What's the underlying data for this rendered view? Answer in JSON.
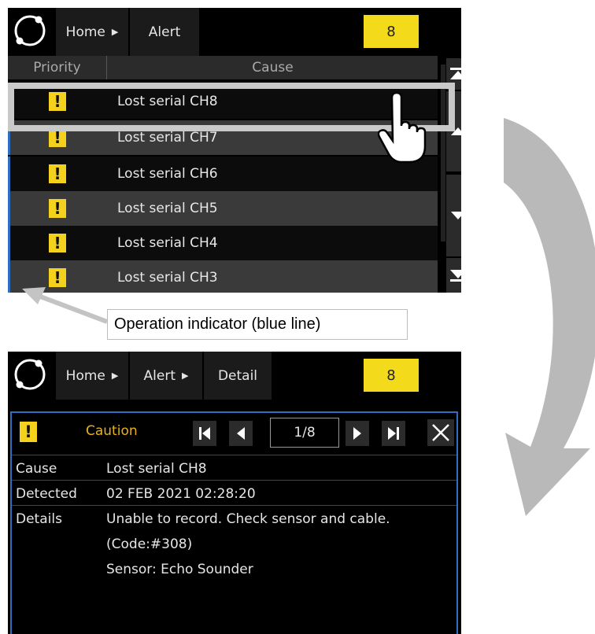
{
  "top_screen": {
    "breadcrumb": [
      "Home",
      "Alert"
    ],
    "alert_count": "8",
    "table": {
      "headers": [
        "Priority",
        "Cause"
      ],
      "rows": [
        {
          "priority_icon": "warning-icon",
          "cause": "Lost serial CH8"
        },
        {
          "priority_icon": "warning-icon",
          "cause": "Lost serial CH7"
        },
        {
          "priority_icon": "warning-icon",
          "cause": "Lost serial CH6"
        },
        {
          "priority_icon": "warning-icon",
          "cause": "Lost serial CH5"
        },
        {
          "priority_icon": "warning-icon",
          "cause": "Lost serial CH4"
        },
        {
          "priority_icon": "warning-icon",
          "cause": "Lost serial CH3"
        }
      ]
    },
    "scroll_buttons": [
      "scroll-top-icon",
      "scroll-up-icon",
      "scroll-down-icon",
      "scroll-bottom-icon"
    ]
  },
  "callout": "Operation indicator (blue line)",
  "bottom_screen": {
    "breadcrumb": [
      "Home",
      "Alert",
      "Detail"
    ],
    "alert_count": "8",
    "detail": {
      "priority_label": "Caution",
      "page": "1/8",
      "rows": [
        {
          "label": "Cause",
          "lines": [
            "Lost serial CH8"
          ]
        },
        {
          "label": "Detected",
          "lines": [
            "02 FEB 2021 02:28:20"
          ]
        },
        {
          "label": "Details",
          "lines": [
            "Unable to record. Check sensor and cable.",
            "(Code:#308)",
            "Sensor: Echo Sounder"
          ]
        }
      ]
    }
  },
  "colors": {
    "badge": "#f3da1a",
    "warning": "#f3d11c",
    "operation_line": "#2f6fc1",
    "caution_text": "#e8b21a",
    "arrow": "#b9b9b9"
  }
}
